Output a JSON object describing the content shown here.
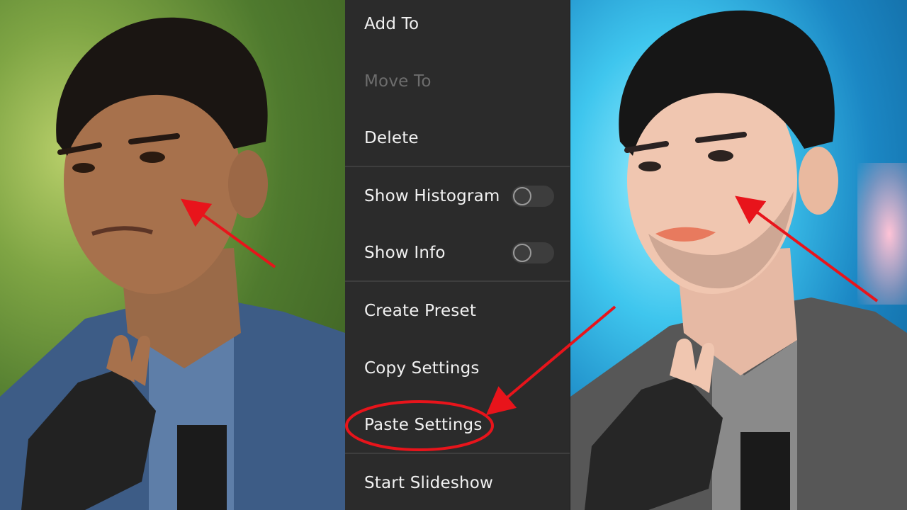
{
  "menu": {
    "items": [
      {
        "label": "Add To",
        "enabled": true
      },
      {
        "label": "Move To",
        "enabled": false
      },
      {
        "label": "Delete",
        "enabled": true
      },
      {
        "label": "Show Histogram",
        "enabled": true,
        "toggle": false
      },
      {
        "label": "Show Info",
        "enabled": true,
        "toggle": false
      },
      {
        "label": "Create Preset",
        "enabled": true
      },
      {
        "label": "Copy Settings",
        "enabled": true
      },
      {
        "label": "Paste Settings",
        "enabled": true,
        "highlighted": true
      },
      {
        "label": "Start Slideshow",
        "enabled": true
      }
    ]
  },
  "photos": {
    "before": {
      "subject": "man in blue denim shirt, green background"
    },
    "after": {
      "subject": "man in grey shirt, blue background"
    }
  },
  "colors": {
    "menu_bg": "#2b2b2b",
    "annotation": "#e8141b",
    "disabled_text": "#6d6d6d"
  }
}
